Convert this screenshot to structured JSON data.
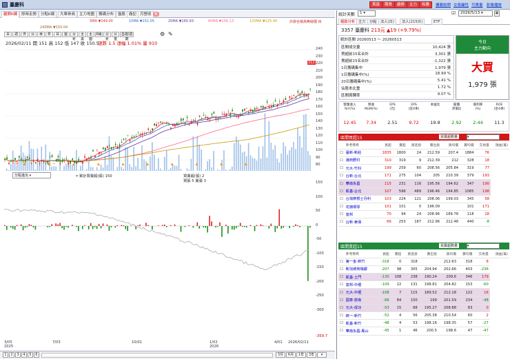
{
  "app": {
    "title": "臺慶科",
    "top_buttons": [
      "首頁",
      "期貨",
      "趨勢",
      "主力",
      "吸籌"
    ],
    "top_links": [
      "擴展說明",
      "交易屬性",
      "可賣量",
      "影像播放"
    ]
  },
  "tabs": [
    "趨勢K線",
    "即時走勢",
    "分點K線",
    "大單券商",
    "主力地圖",
    "籌碼分布",
    "盤股",
    "廠記",
    "月營收",
    "新"
  ],
  "ma_legend": [
    {
      "label": "5MA ▼149.00",
      "color": "#cc3333"
    },
    {
      "label": "10MA ▼151.05",
      "color": "#3366cc"
    },
    {
      "label": "20MA ▼160.93",
      "color": "#663399"
    },
    {
      "label": "60MA ▼156.13",
      "color": "#ff6688"
    },
    {
      "label": "120MA ▼125.40",
      "color": "#cc9900"
    },
    {
      "label": "240MA ▼150.04",
      "color": "#996633"
    }
  ],
  "toolbar": [
    "日",
    "週",
    "月",
    "分",
    "季",
    "年",
    "日",
    "盤",
    "分析",
    "主表",
    "主圖",
    "K線",
    "分析",
    "分量",
    "自選/週期"
  ],
  "toolbar_note": "外掛名稱為無線價 目",
  "ohlc": "2026/02/11 開 151 高 152 低 147 收 150.5",
  "ohlc_change": "漲跌 1.5 漲幅 1.01% 量 910",
  "price_ticks": [
    "240",
    "230",
    "220",
    "210",
    "200",
    "190",
    "180",
    "170",
    "160",
    "150",
    "140",
    "130",
    "120",
    "110",
    "100",
    "90",
    "80"
  ],
  "marker_high": "212",
  "marker_low": "80.7",
  "lower": {
    "selector": "分點進出",
    "legend": "━ 累計買賣超(張) 150",
    "buy_legend": "買賣超(張) 2",
    "buy_legend2": "買張 5 賣張 3",
    "ticks": [
      "150",
      "100",
      "50",
      "0",
      "-50",
      "-100",
      "-150",
      "-200",
      "-250",
      "-300"
    ],
    "last": "-359.7"
  },
  "xaxis": [
    "3/05\n2025",
    "7/03",
    "10/01",
    "1/02\n2026",
    "4/01",
    "2026/02/11"
  ],
  "bottom_pages": [
    "1",
    "2",
    "3",
    "4",
    "5",
    "6"
  ],
  "bottom_ranges": [
    "3月",
    "6月",
    "1年",
    "3年",
    "▾"
  ],
  "right": {
    "stat_days_label": "統計天數",
    "stat_days": "1",
    "date": "2026/5/13",
    "tabs": [
      "趨勢分析",
      "主力",
      "分點",
      "法人(日)",
      "法人(215日)",
      "ETF"
    ],
    "stock": {
      "code": "3357",
      "name": "臺慶科",
      "price": "213元",
      "change": "▲19",
      "pct": "(+9.79%)"
    },
    "summary_title": "統計區間  20260513 ～ 20260513",
    "summary": [
      {
        "k": "區間成交量",
        "v": "10,424 張"
      },
      {
        "k": "買超前15名合計",
        "v": "3,301 張"
      },
      {
        "k": "賣超前15名合計",
        "v": "-1,322 張"
      },
      {
        "k": "1日籌碼集中",
        "v": "1,979 張"
      },
      {
        "k": "1日籌碼集中(%)",
        "v": "18.99 %"
      },
      {
        "k": "20日籌碼集中(%)",
        "v": "5.41 %"
      },
      {
        "k": "佔股本比重",
        "v": "1.72 %"
      },
      {
        "k": "區間周轉率",
        "v": "9.07 %"
      }
    ],
    "today": {
      "title1": "今日",
      "title2": "主力動向",
      "action": "大買",
      "amount": "1,979 張"
    },
    "fin_headers": [
      "營業收入\nYoY(%)",
      "營收\nMoM(%)",
      "EPS\n(元)",
      "EPS\n(近4季)",
      "本益比",
      "股價\n淨值比",
      "殖利率\n(%)",
      "ROE\n(近4季)"
    ],
    "fin_values": [
      "12.45",
      "7.34",
      "2.51",
      "9.72",
      "19.8",
      "2.92",
      "2.44",
      "11.3"
    ],
    "buy_title": "區間買超15",
    "sell_title": "區間賣超15",
    "col_headers": [
      "參考券商",
      "買超",
      "賣超",
      "買進張",
      "賣出張",
      "買均價",
      "賣均價",
      "交易量",
      "損益(萬)"
    ],
    "select_label": "買賣超數量",
    "buy": [
      [
        "臺新-新莊",
        "1835",
        "1800",
        "24",
        "212.59",
        "207.4",
        "1884",
        "76"
      ],
      [
        "港商野村",
        "310",
        "319",
        "9",
        "212.39",
        "212",
        "328",
        "18"
      ],
      [
        "元大-竹科",
        "199",
        "259",
        "60",
        "208.56",
        "205.84",
        "319",
        "77"
      ],
      [
        "台新-台北",
        "171",
        "275",
        "104",
        "205",
        "210.39",
        "379",
        "193"
      ],
      [
        "華南永昌",
        "115",
        "231",
        "116",
        "195.56",
        "194.62",
        "347",
        "190"
      ],
      [
        "凱基-台北",
        "107",
        "596",
        "489",
        "196.46",
        "194.85",
        "1085",
        "198"
      ],
      [
        "台灣摩根士丹利",
        "103",
        "224",
        "121",
        "208.06",
        "199.03",
        "345",
        "58"
      ],
      [
        "花旗環球",
        "101",
        "101",
        "0",
        "196.09",
        "",
        "101",
        "171"
      ],
      [
        "富邦",
        "70",
        "94",
        "24",
        "208.96",
        "189.78",
        "118",
        "18"
      ],
      [
        "台新-東保",
        "66",
        "253",
        "187",
        "212.96",
        "212.48",
        "440",
        "-8"
      ]
    ],
    "sell": [
      [
        "第一金-新竹",
        "-318",
        "0",
        "318",
        "",
        "212.63",
        "318",
        "8"
      ],
      [
        "新加坡商瑞銀",
        "-207",
        "98",
        "305",
        "204.94",
        "202.66",
        "403",
        "-236"
      ],
      [
        "凱基-土門",
        "-130",
        "108",
        "238",
        "190.24",
        "209.6",
        "346",
        "179"
      ],
      [
        "富邦-中壢",
        "-109",
        "22",
        "131",
        "198.81",
        "204.82",
        "153",
        "-60"
      ],
      [
        "元大-中壢",
        "-108",
        "7",
        "115",
        "189.52",
        "212.18",
        "122",
        "16"
      ],
      [
        "國泰-敦南",
        "-66",
        "84",
        "150",
        "199",
        "201.59",
        "234",
        "-48"
      ],
      [
        "元大-成功",
        "-53",
        "15",
        "68",
        "195.27",
        "208.88",
        "83",
        "0"
      ],
      [
        "統一-新竹",
        "-52",
        "4",
        "56",
        "205.38",
        "210.54",
        "60",
        "2"
      ],
      [
        "凱基-新竹",
        "-48",
        "4",
        "53",
        "198.16",
        "198.35",
        "57",
        "-27"
      ],
      [
        "華南永昌-鳳山",
        "-45",
        "1",
        "46",
        "200.5",
        "198.6",
        "47",
        "-47"
      ]
    ]
  }
}
